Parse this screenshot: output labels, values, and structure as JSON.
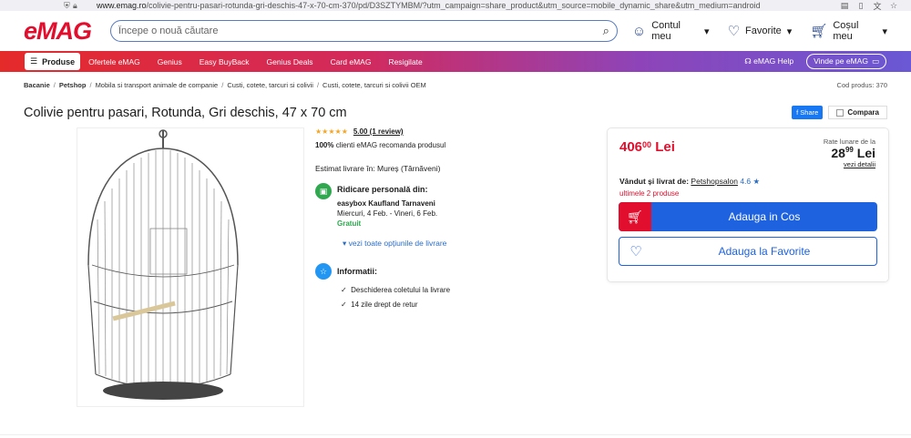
{
  "browser": {
    "url_domain": "www.emag.ro",
    "url_path": "/colivie-pentru-pasari-rotunda-gri-deschis-47-x-70-cm-370/pd/D3SZTYMBM/?utm_campaign=share_product&utm_source=mobile_dynamic_share&utm_medium=android"
  },
  "header": {
    "logo": "eMAG",
    "search_placeholder": "Începe o nouă căutare",
    "account": "Contul meu",
    "favorites": "Favorite",
    "cart": "Coșul meu"
  },
  "nav": {
    "products": "Produse",
    "links": [
      "Ofertele eMAG",
      "Genius",
      "Easy BuyBack",
      "Genius Deals",
      "Card eMAG",
      "Resigilate"
    ],
    "help": "eMAG Help",
    "sell": "Vinde pe eMAG"
  },
  "breadcrumb": {
    "items": [
      "Bacanie",
      "Petshop",
      "Mobila si transport animale de companie",
      "Custi, cotete, tarcuri si colivii",
      "Custi, cotete, tarcuri si colivii OEM"
    ],
    "code": "Cod produs: 370"
  },
  "product": {
    "title": "Colivie pentru pasari, Rotunda, Gri deschis, 47 x 70 cm",
    "share": "Share",
    "compare": "Compara",
    "stars": "★★★★★",
    "rating": "5.00",
    "reviews": "(1 review)",
    "recommend_pct": "100%",
    "recommend_text": "clienti eMAG recomanda produsul",
    "delivery_estimate": "Estimat livrare în: Mureș (Târnăveni)",
    "pickup_title": "Ridicare personală din:",
    "pickup_location": "easybox Kaufland Tarnaveni",
    "pickup_dates": "Miercuri, 4 Feb. - Vineri, 6 Feb.",
    "pickup_price": "Gratuit",
    "delivery_options_link": "vezi toate opțiunile de livrare",
    "info_title": "Informatii:",
    "info_items": [
      "Deschiderea coletului la livrare",
      "14 zile drept de retur"
    ]
  },
  "buybox": {
    "price_int": "406",
    "price_dec": "00",
    "currency": "Lei",
    "installments_label": "Rate lunare de la",
    "installment_int": "28",
    "installment_dec": "99",
    "installment_currency": "Lei",
    "installment_details": "vezi detalii",
    "sold_by_label": "Vândut și livrat de:",
    "seller": "Petshopsalon",
    "seller_rating": "4.6 ★",
    "stock": "ultimele 2 produse",
    "add_to_cart": "Adauga in Cos",
    "add_to_fav": "Adauga la Favorite"
  },
  "colors": {
    "brand_red": "#e20e2d",
    "brand_blue": "#1e62e0",
    "green": "#2fa84f"
  }
}
